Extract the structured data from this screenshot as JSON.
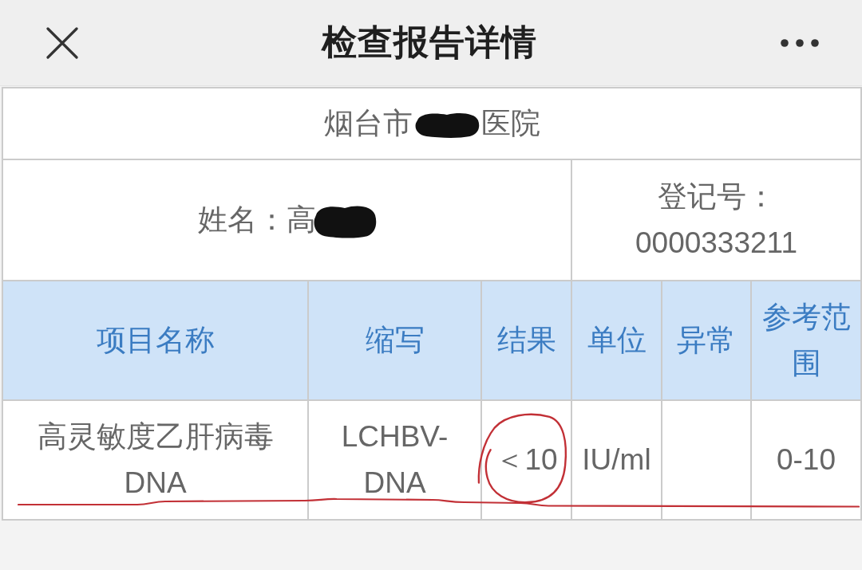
{
  "top_bar": {
    "title": "检查报告详情"
  },
  "report": {
    "hospital": {
      "prefix": "烟台市",
      "redacted": true,
      "suffix": "医院"
    },
    "patient": {
      "label": "姓名：",
      "value": "高",
      "redacted": true
    },
    "registration": {
      "label": "登记号：",
      "value": "0000333211"
    },
    "table": {
      "columns": [
        "项目名称",
        "缩写",
        "结果",
        "单位",
        "异常",
        "参考范围"
      ],
      "rows": [
        {
          "item": "高灵敏度乙肝病毒DNA",
          "abbreviation": "LCHBV-DNA",
          "result": "＜10",
          "unit": "IU/ml",
          "reference_range": "0-10",
          "result_circled": true,
          "underlined": true
        }
      ]
    }
  }
}
